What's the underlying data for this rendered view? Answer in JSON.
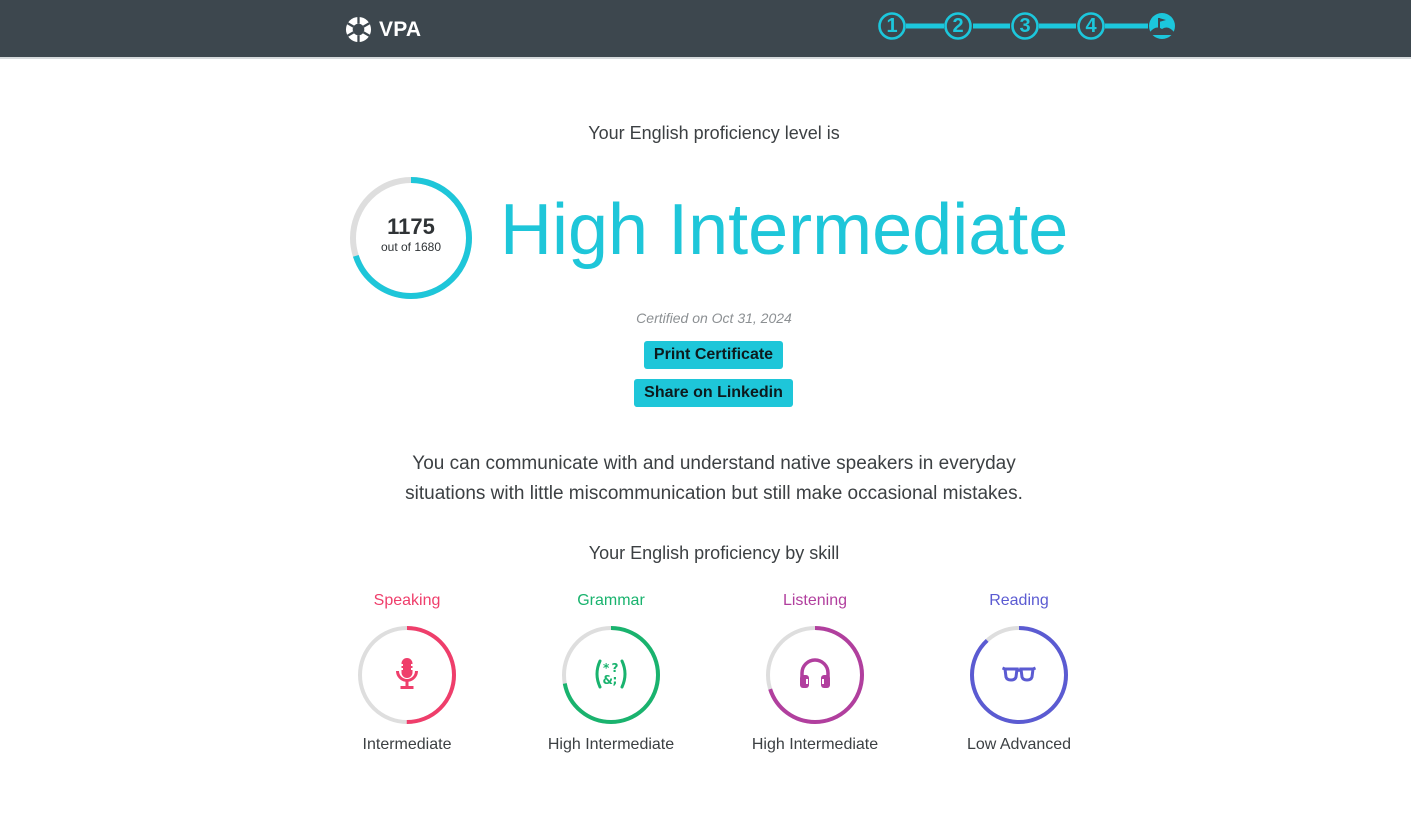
{
  "header": {
    "logo_text": "VPA",
    "steps": [
      "1",
      "2",
      "3",
      "4"
    ],
    "accent_color": "#1cc7dc",
    "bar_color": "#3d474e"
  },
  "result": {
    "intro": "Your English proficiency level is",
    "score": "1175",
    "score_max_label": "out of 1680",
    "score_fraction": 0.6994,
    "level": "High Intermediate",
    "certified": "Certified on Oct 31, 2024",
    "print_button": "Print Certificate",
    "share_button": "Share on Linkedin",
    "description": "You can communicate with and understand native speakers in everyday situations with little miscommunication but still make occasional mistakes.",
    "accent_color": "#1ec6d9"
  },
  "skills": {
    "heading": "Your English proficiency by skill",
    "items": [
      {
        "name": "Speaking",
        "level": "Intermediate",
        "color": "#ef3e6b",
        "progress": 0.5,
        "icon": "microphone-icon"
      },
      {
        "name": "Grammar",
        "level": "High Intermediate",
        "color": "#19b36e",
        "progress": 0.72,
        "icon": "grammar-symbols-icon"
      },
      {
        "name": "Listening",
        "level": "High Intermediate",
        "color": "#b13f9e",
        "progress": 0.7,
        "icon": "headphones-icon"
      },
      {
        "name": "Reading",
        "level": "Low Advanced",
        "color": "#5b5bd2",
        "progress": 0.88,
        "icon": "glasses-icon"
      }
    ]
  }
}
